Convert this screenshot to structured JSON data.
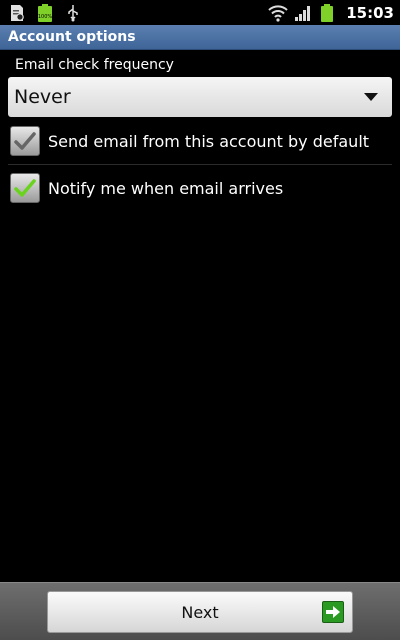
{
  "status_bar": {
    "time": "15:03",
    "icons": [
      "sd-card-settings-icon",
      "battery-full-notification-icon",
      "usb-icon",
      "wifi-icon",
      "signal-icon",
      "battery-icon"
    ],
    "battery_notification_text": "100%"
  },
  "title_bar": {
    "title": "Account options"
  },
  "frequency": {
    "label": "Email check frequency",
    "selected": "Never"
  },
  "options": [
    {
      "label": "Send email from this account by default",
      "checked": true,
      "enabled": false
    },
    {
      "label": "Notify me when email arrives",
      "checked": true,
      "enabled": true
    }
  ],
  "bottom_bar": {
    "next_label": "Next"
  },
  "colors": {
    "title_bar": "#4a6fa5",
    "check_enabled": "#6ad31e",
    "check_disabled": "#666666",
    "next_arrow": "#2a9a22"
  }
}
